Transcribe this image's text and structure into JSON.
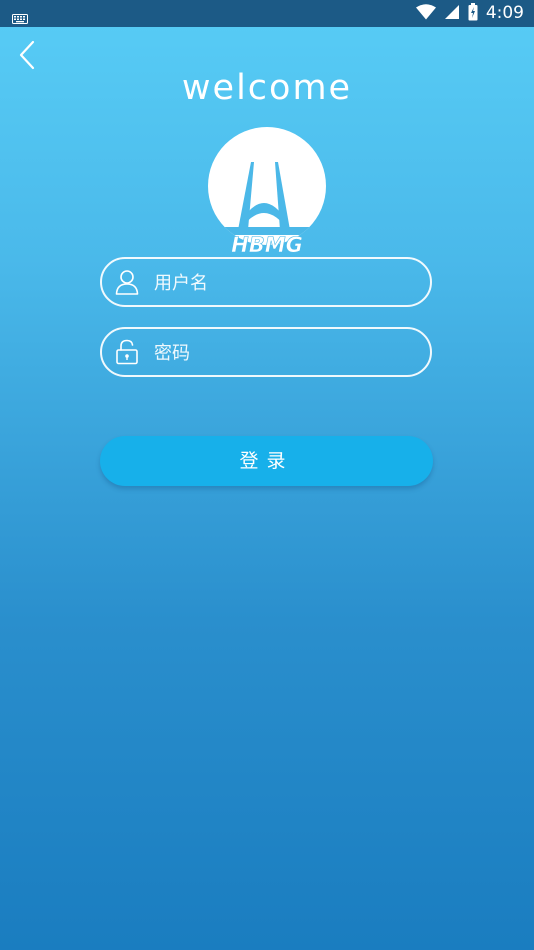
{
  "status_bar": {
    "time": "4:09",
    "icons": [
      "keyboard-icon",
      "wifi-icon",
      "signal-icon",
      "battery-icon"
    ]
  },
  "header": {
    "back_icon": "chevron-left-icon",
    "welcome": "welcome"
  },
  "logo": {
    "text": "HBMG"
  },
  "form": {
    "username_placeholder": "用户名",
    "password_placeholder": "密码",
    "username_icon": "user-icon",
    "password_icon": "lock-icon",
    "login_label": "登录"
  },
  "colors": {
    "gradient_top": "#58cdf6",
    "gradient_bottom": "#1a7dc0",
    "status_bar": "#1c5a86",
    "button": "#17b0ea",
    "text": "#ffffff"
  }
}
